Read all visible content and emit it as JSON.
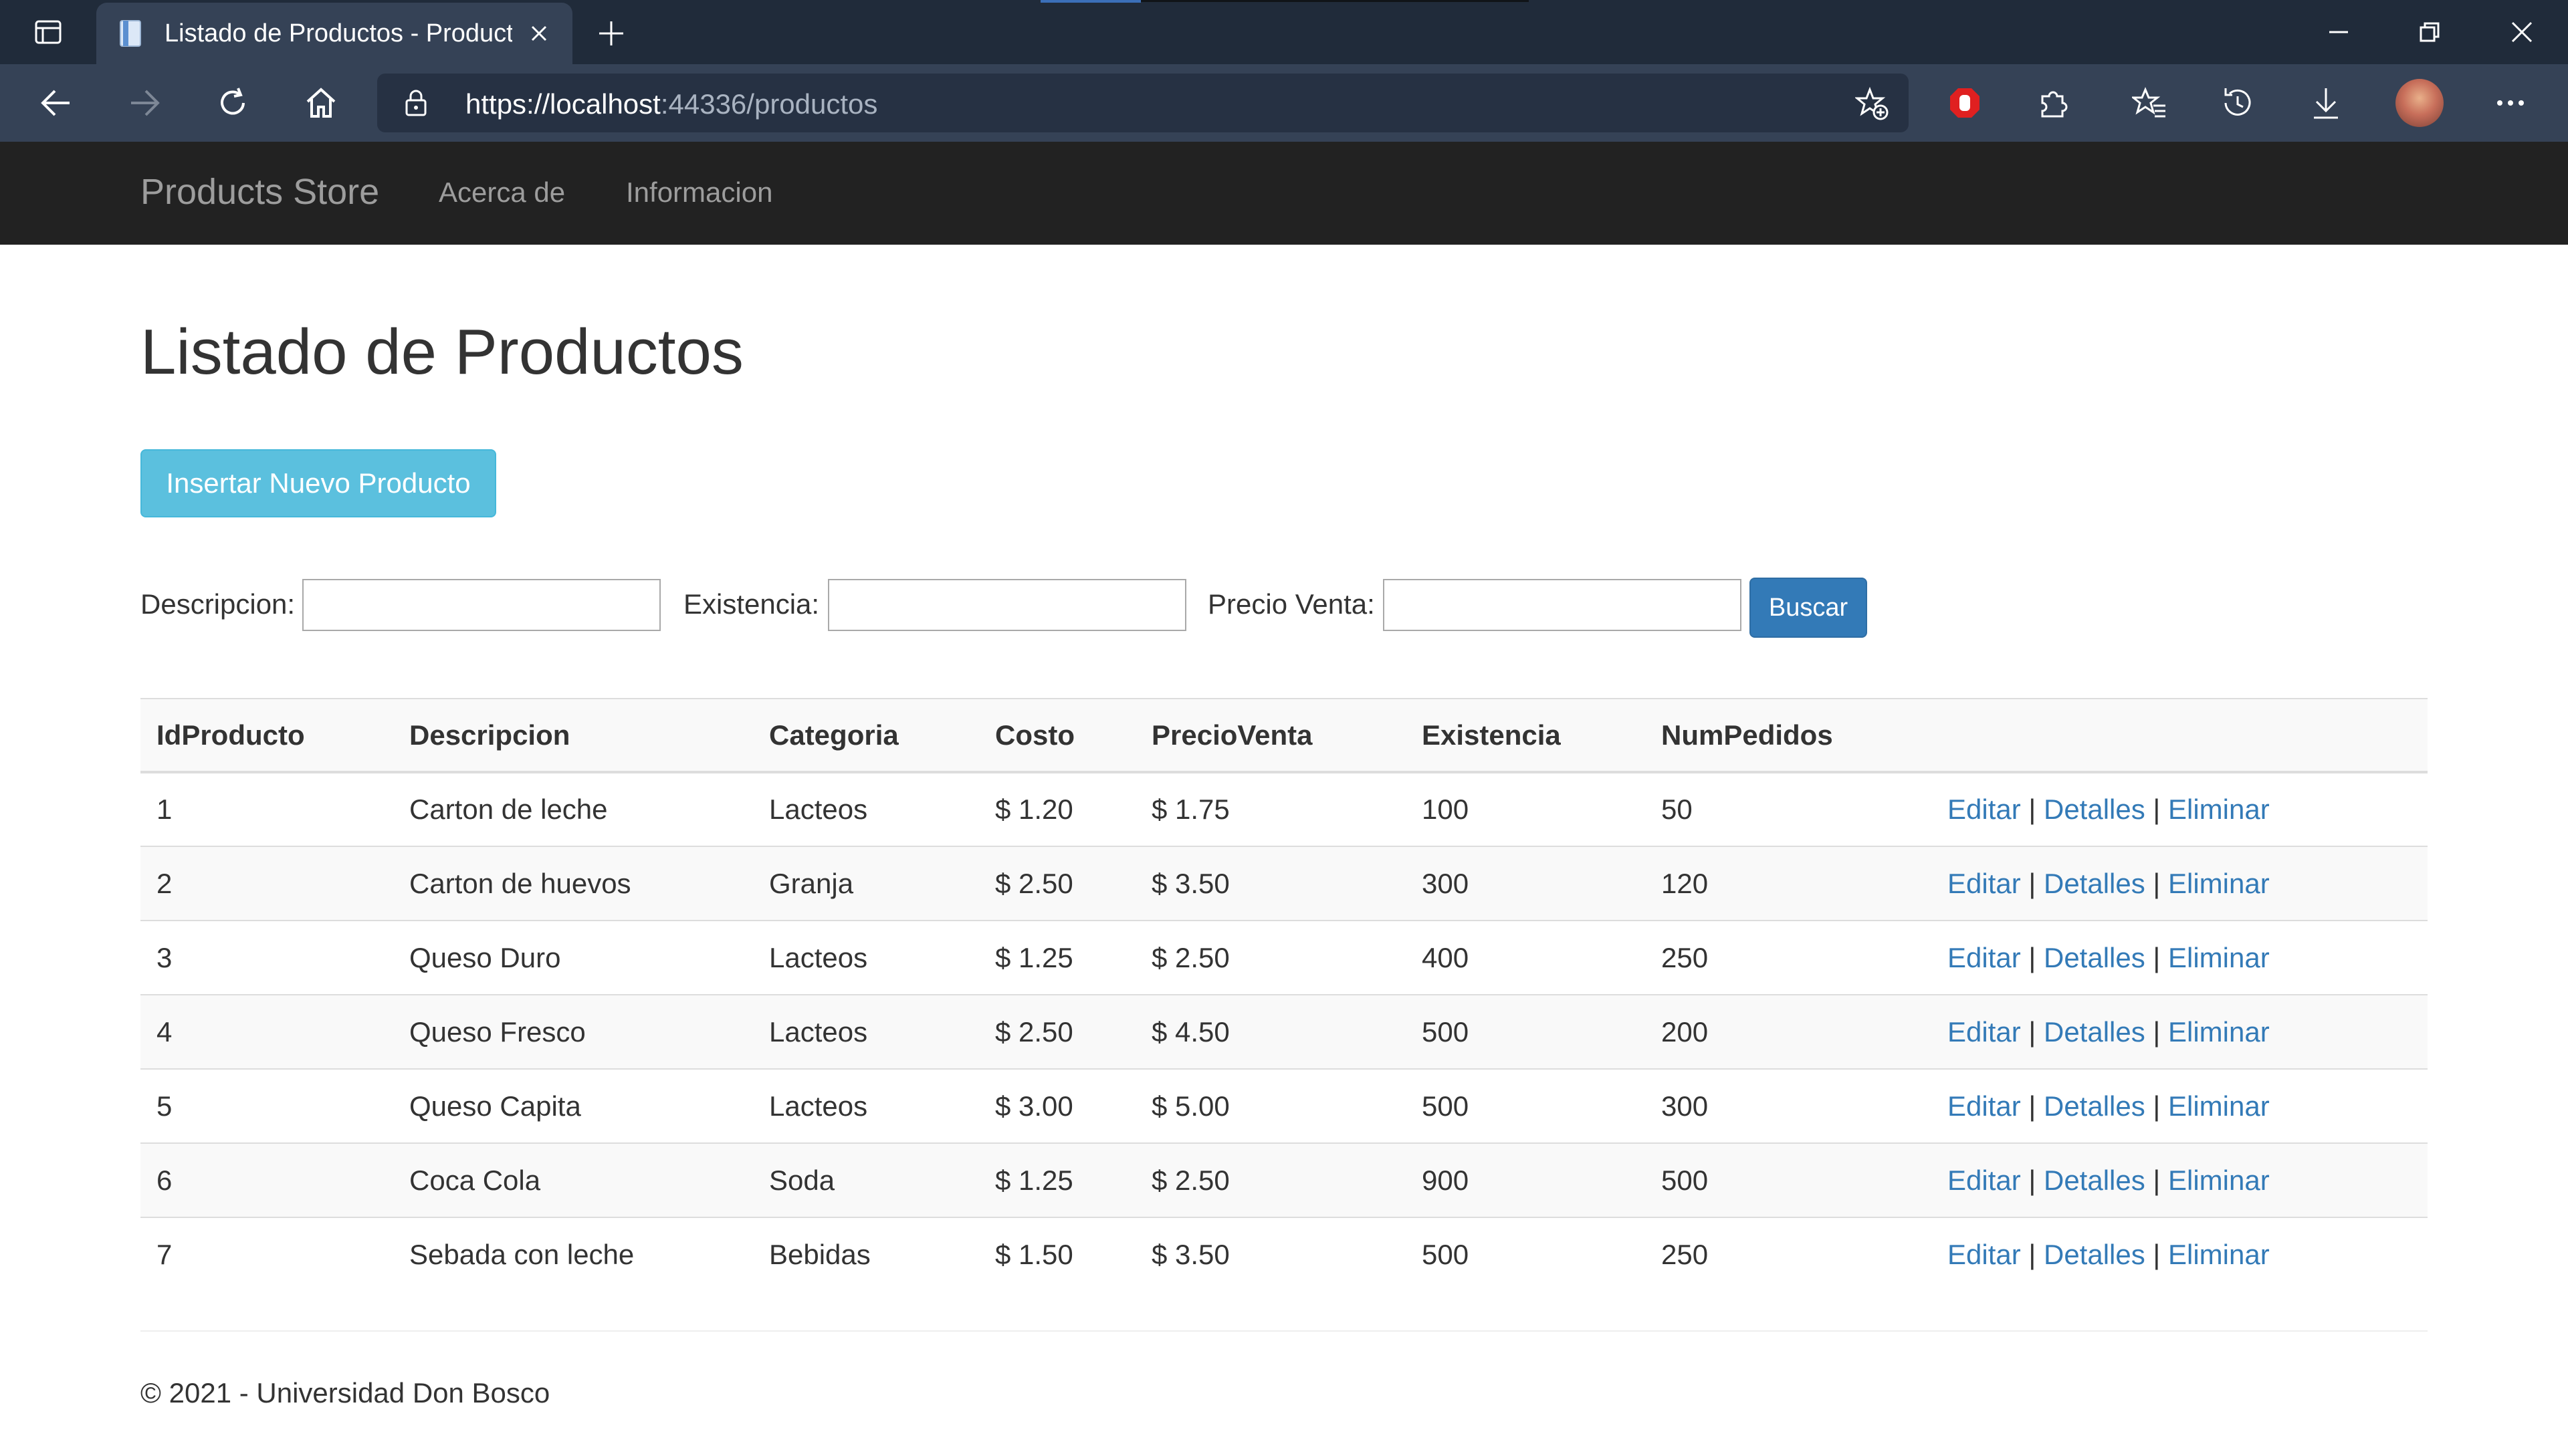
{
  "browser": {
    "tab_title": "Listado de Productos - Products",
    "url_scheme_host": "https://localhost",
    "url_port_path": ":44336/productos"
  },
  "colors": {
    "navbar_bg": "#222222",
    "link": "#337ab7",
    "info_button": "#5bc0de",
    "primary_button": "#337ab7"
  },
  "navbar": {
    "brand": "Products Store",
    "links": [
      "Acerca de",
      "Informacion"
    ]
  },
  "main": {
    "title": "Listado de Productos",
    "insert_button": "Insertar Nuevo Producto",
    "search": {
      "descripcion_label": "Descripcion:",
      "descripcion_value": "",
      "existencia_label": "Existencia:",
      "existencia_value": "",
      "precio_label": "Precio Venta:",
      "precio_value": "",
      "button": "Buscar"
    },
    "table": {
      "headers": [
        "IdProducto",
        "Descripcion",
        "Categoria",
        "Costo",
        "PrecioVenta",
        "Existencia",
        "NumPedidos",
        ""
      ],
      "actions": {
        "edit": "Editar",
        "details": "Detalles",
        "delete": "Eliminar",
        "separator": "|"
      },
      "rows": [
        [
          "1",
          "Carton de leche",
          "Lacteos",
          "$ 1.20",
          "$ 1.75",
          "100",
          "50"
        ],
        [
          "2",
          "Carton de huevos",
          "Granja",
          "$ 2.50",
          "$ 3.50",
          "300",
          "120"
        ],
        [
          "3",
          "Queso Duro",
          "Lacteos",
          "$ 1.25",
          "$ 2.50",
          "400",
          "250"
        ],
        [
          "4",
          "Queso Fresco",
          "Lacteos",
          "$ 2.50",
          "$ 4.50",
          "500",
          "200"
        ],
        [
          "5",
          "Queso Capita",
          "Lacteos",
          "$ 3.00",
          "$ 5.00",
          "500",
          "300"
        ],
        [
          "6",
          "Coca Cola",
          "Soda",
          "$ 1.25",
          "$ 2.50",
          "900",
          "500"
        ],
        [
          "7",
          "Sebada con leche",
          "Bebidas",
          "$ 1.50",
          "$ 3.50",
          "500",
          "250"
        ]
      ]
    }
  },
  "footer": {
    "text": "© 2021 - Universidad Don Bosco"
  }
}
